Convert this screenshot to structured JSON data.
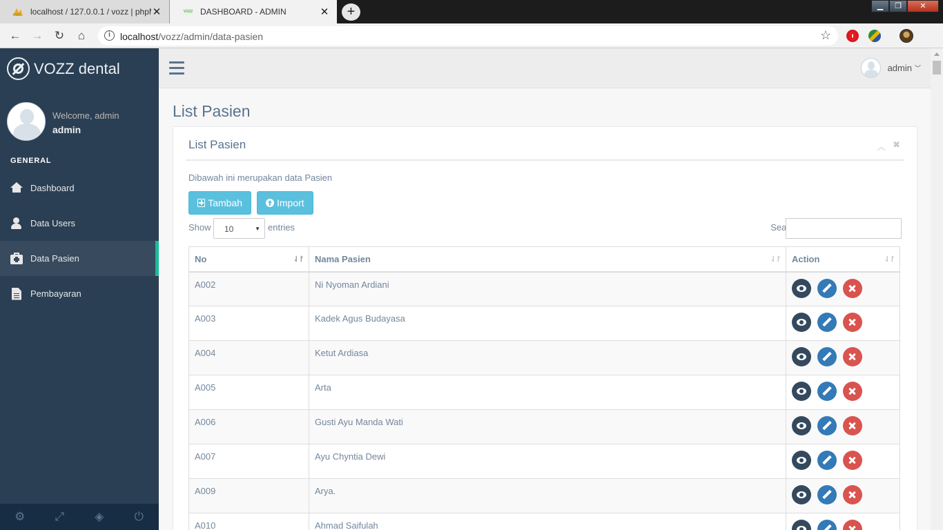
{
  "browser": {
    "tabs": [
      {
        "title": "localhost / 127.0.0.1 / vozz | phpMyAdmin",
        "active": false
      },
      {
        "title": "DASHBOARD - ADMIN",
        "active": true
      }
    ],
    "url_host": "localhost",
    "url_path": "/vozz/admin/data-pasien"
  },
  "sidebar": {
    "brand": "VOZZ dental",
    "welcome": "Welcome, admin",
    "user": "admin",
    "section": "GENERAL",
    "items": [
      {
        "label": "Dashboard",
        "icon": "home-icon",
        "active": false
      },
      {
        "label": "Data Users",
        "icon": "user-icon",
        "active": false
      },
      {
        "label": "Data Pasien",
        "icon": "medkit-icon",
        "active": true
      },
      {
        "label": "Pembayaran",
        "icon": "file-icon",
        "active": false
      }
    ],
    "footer_icons": [
      "settings-icon",
      "fullscreen-icon",
      "lock-icon",
      "power-icon"
    ]
  },
  "topnav": {
    "user": "admin"
  },
  "page": {
    "title": "List Pasien",
    "panel_title": "List Pasien",
    "description": "Dibawah ini merupakan data Pasien",
    "btn_tambah": "Tambah",
    "btn_import": "Import",
    "show_label": "Show",
    "show_value": "10",
    "entries_label": "entries",
    "search_label": "Search:"
  },
  "table": {
    "columns": [
      "No",
      "Nama Pasien",
      "Action"
    ],
    "rows": [
      {
        "no": "A002",
        "nama": "Ni Nyoman Ardiani"
      },
      {
        "no": "A003",
        "nama": "Kadek Agus Budayasa"
      },
      {
        "no": "A004",
        "nama": "Ketut Ardiasa"
      },
      {
        "no": "A005",
        "nama": "Arta"
      },
      {
        "no": "A006",
        "nama": "Gusti Ayu Manda Wati"
      },
      {
        "no": "A007",
        "nama": "Ayu Chyntia Dewi"
      },
      {
        "no": "A009",
        "nama": "Arya."
      },
      {
        "no": "A010",
        "nama": "Ahmad Saifulah"
      }
    ]
  },
  "colors": {
    "sidebar_bg": "#2A3F54",
    "active_accent": "#1ABB9C",
    "info_button": "#5BC0DE",
    "view_button": "#34495E",
    "edit_button": "#337AB7",
    "delete_button": "#D9534F"
  }
}
